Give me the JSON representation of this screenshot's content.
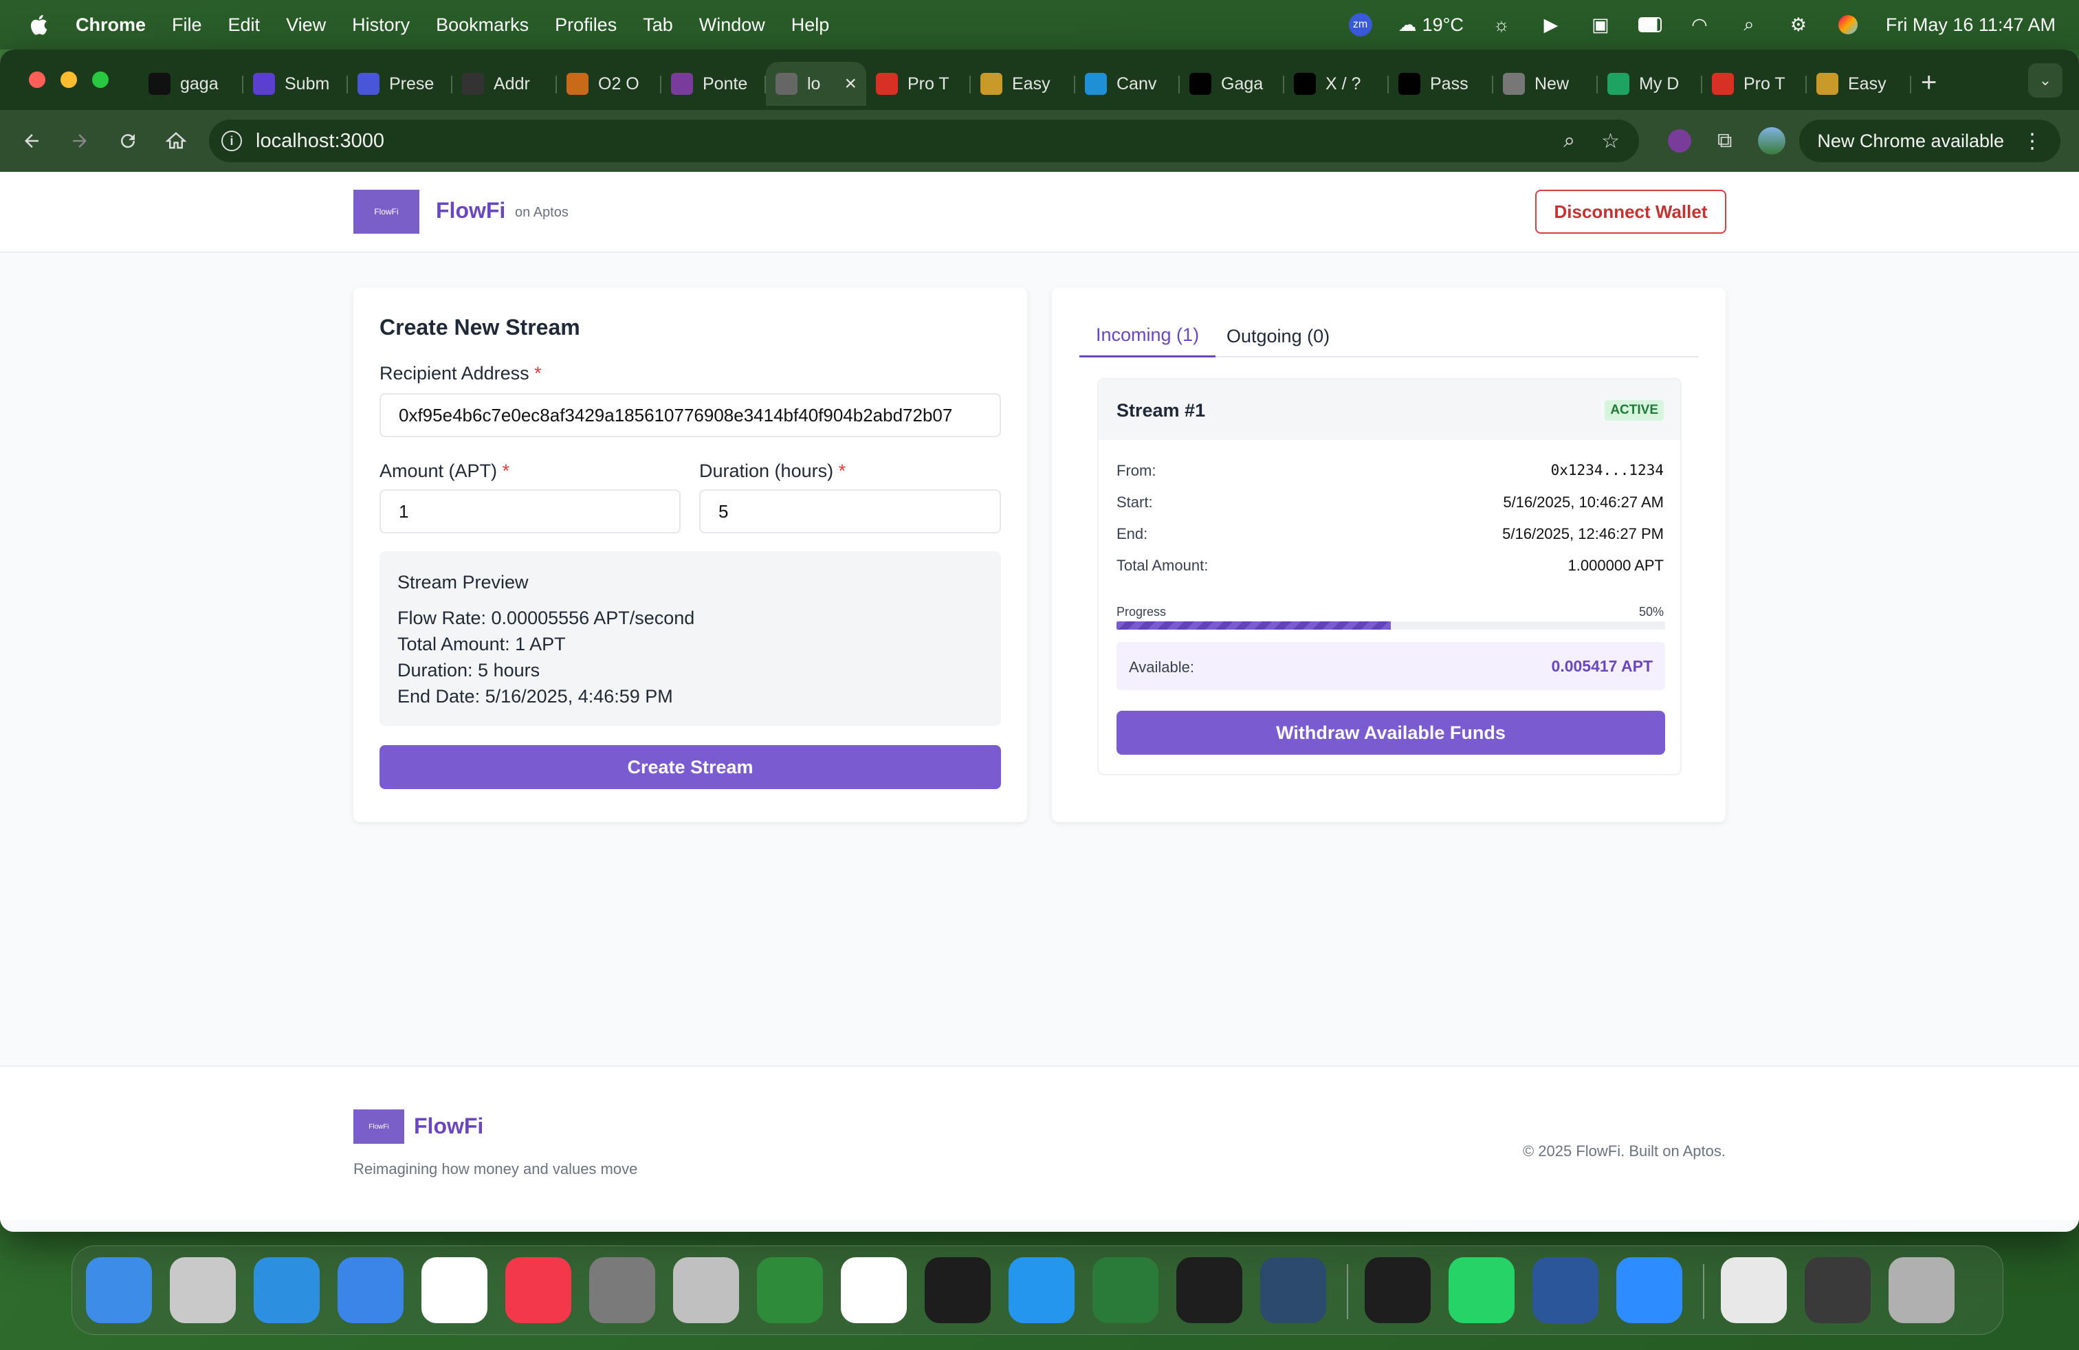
{
  "menubar": {
    "app": "Chrome",
    "items": [
      "File",
      "Edit",
      "View",
      "History",
      "Bookmarks",
      "Profiles",
      "Tab",
      "Window",
      "Help"
    ],
    "weather": "19°C",
    "zm": "zm",
    "datetime": "Fri May 16  11:47 AM"
  },
  "browser": {
    "tabs": [
      {
        "label": "gaga",
        "icon": "github-icon",
        "color": "#111"
      },
      {
        "label": "Subm",
        "icon": "form-icon",
        "color": "#5b3fd0"
      },
      {
        "label": "Prese",
        "icon": "shield-icon",
        "color": "#4a56d8"
      },
      {
        "label": "Addr",
        "icon": "address-icon",
        "color": "#333"
      },
      {
        "label": "O2 O",
        "icon": "basketball-icon",
        "color": "#c96a1a"
      },
      {
        "label": "Ponte",
        "icon": "pontem-icon",
        "color": "#7a3c9a"
      },
      {
        "label": "lo",
        "icon": "globe-icon",
        "color": "#666",
        "active": true
      },
      {
        "label": "Pro T",
        "icon": "gmail-icon",
        "color": "#d93025"
      },
      {
        "label": "Easy",
        "icon": "person-icon",
        "color": "#c99a2a"
      },
      {
        "label": "Canv",
        "icon": "canva-icon",
        "color": "#1f8fd6"
      },
      {
        "label": "Gaga",
        "icon": "x-icon",
        "color": "#000"
      },
      {
        "label": "X / ?",
        "icon": "x-icon",
        "color": "#000"
      },
      {
        "label": "Pass",
        "icon": "x-icon",
        "color": "#000"
      },
      {
        "label": "New",
        "icon": "chrome-icon",
        "color": "#777"
      },
      {
        "label": "My D",
        "icon": "drive-icon",
        "color": "#1ea362"
      },
      {
        "label": "Pro T",
        "icon": "gmail-icon",
        "color": "#d93025"
      },
      {
        "label": "Easy",
        "icon": "person-icon",
        "color": "#c99a2a"
      }
    ],
    "url": "localhost:3000",
    "update_label": "New Chrome available"
  },
  "app": {
    "brand": "FlowFi",
    "brand_sub": "on Aptos",
    "logo_text": "FlowFi",
    "disconnect_label": "Disconnect Wallet",
    "create": {
      "title": "Create New Stream",
      "recipient_label": "Recipient Address",
      "recipient_value": "0xf95e4b6c7e0ec8af3429a185610776908e3414bf40f904b2abd72b07",
      "amount_label": "Amount (APT)",
      "amount_value": "1",
      "duration_label": "Duration (hours)",
      "duration_value": "5",
      "required_mark": "*",
      "preview_title": "Stream Preview",
      "preview_flow_rate": "Flow Rate: 0.00005556 APT/second",
      "preview_total": "Total Amount: 1 APT",
      "preview_duration": "Duration: 5 hours",
      "preview_end": "End Date: 5/16/2025, 4:46:59 PM",
      "submit_label": "Create Stream"
    },
    "streams": {
      "tab_incoming": "Incoming (1)",
      "tab_outgoing": "Outgoing (0)",
      "title": "Stream #1",
      "status": "ACTIVE",
      "from_label": "From:",
      "from_value": "0x1234...1234",
      "start_label": "Start:",
      "start_value": "5/16/2025, 10:46:27 AM",
      "end_label": "End:",
      "end_value": "5/16/2025, 12:46:27 PM",
      "total_label": "Total Amount:",
      "total_value": "1.000000 APT",
      "progress_label": "Progress",
      "progress_text": "50%",
      "progress_fraction": 0.5,
      "available_label": "Available:",
      "available_value": "0.005417 APT",
      "withdraw_label": "Withdraw Available Funds"
    },
    "footer": {
      "brand": "FlowFi",
      "tagline": "Reimagining how money and values move",
      "copyright": "© 2025 FlowFi. Built on Aptos."
    }
  },
  "colors": {
    "accent": "#7b5cd0",
    "brand_text": "#6b46c1",
    "danger": "#c53030",
    "active_badge": "#1f7a3a"
  },
  "dock": [
    "finder-icon",
    "launchpad-icon",
    "safari-icon",
    "mail-icon",
    "chrome-icon",
    "music-icon",
    "settings-icon",
    "iphone-mirroring-icon",
    "circle-app-icon",
    "vscode-icon",
    "ollama-icon",
    "docker-icon",
    "vectorworks-icon",
    "pycharm-icon",
    "mysql-workbench-icon",
    "terminal-icon",
    "whatsapp-icon",
    "word-icon",
    "zoom-icon",
    "window-preview-icon",
    "window-preview-icon",
    "trash-icon"
  ]
}
